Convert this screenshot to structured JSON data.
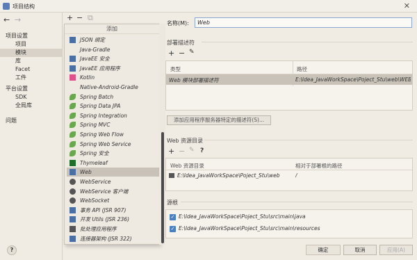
{
  "window": {
    "title": "项目结构",
    "close_glyph": "✕"
  },
  "nav": {
    "back": "←",
    "forward": "→"
  },
  "sidebar": {
    "items": [
      {
        "label": "项目设置",
        "selected": false,
        "indent": false
      },
      {
        "label": "项目",
        "selected": false,
        "indent": true
      },
      {
        "label": "模块",
        "selected": true,
        "indent": true
      },
      {
        "label": "库",
        "selected": false,
        "indent": true
      },
      {
        "label": "Facet",
        "selected": false,
        "indent": true
      },
      {
        "label": "工件",
        "selected": false,
        "indent": true
      },
      {
        "label": "平台设置",
        "selected": false,
        "indent": false
      },
      {
        "label": "SDK",
        "selected": false,
        "indent": true
      },
      {
        "label": "全局库",
        "selected": false,
        "indent": true
      },
      {
        "label": "问题",
        "selected": false,
        "indent": false
      }
    ],
    "help": "?"
  },
  "mid_toolbar": {
    "add": "+",
    "remove": "−",
    "copy": "⧉"
  },
  "add_menu": {
    "header": "添加",
    "items": [
      {
        "label": "JSON 绑定",
        "icon": "json-icon",
        "color": "#4a6fa5",
        "selected": false
      },
      {
        "label": "Java-Gradle",
        "icon": "none",
        "color": "",
        "selected": false
      },
      {
        "label": "JavaEE 安全",
        "icon": "javaee-icon",
        "color": "#4a6fa5",
        "selected": false
      },
      {
        "label": "JavaEE 应用程序",
        "icon": "javaee-icon",
        "color": "#4a6fa5",
        "selected": false
      },
      {
        "label": "Kotlin",
        "icon": "kotlin-icon",
        "color": "#e0508a",
        "selected": false
      },
      {
        "label": "Native-Android-Gradle",
        "icon": "none",
        "color": "",
        "selected": false
      },
      {
        "label": "Spring Batch",
        "icon": "spring-icon",
        "color": "#6aa84f",
        "selected": false
      },
      {
        "label": "Spring Data JPA",
        "icon": "spring-icon",
        "color": "#6aa84f",
        "selected": false
      },
      {
        "label": "Spring Integration",
        "icon": "spring-icon",
        "color": "#6aa84f",
        "selected": false
      },
      {
        "label": "Spring MVC",
        "icon": "spring-icon",
        "color": "#6aa84f",
        "selected": false
      },
      {
        "label": "Spring Web Flow",
        "icon": "spring-icon",
        "color": "#6aa84f",
        "selected": false
      },
      {
        "label": "Spring Web Service",
        "icon": "spring-icon",
        "color": "#6aa84f",
        "selected": false
      },
      {
        "label": "Spring 安全",
        "icon": "spring-icon",
        "color": "#6aa84f",
        "selected": false
      },
      {
        "label": "Thymeleaf",
        "icon": "thymeleaf-icon",
        "color": "#1f6f2b",
        "selected": false
      },
      {
        "label": "Web",
        "icon": "web-icon",
        "color": "#4a6fa5",
        "selected": true
      },
      {
        "label": "WebService",
        "icon": "globe-icon",
        "color": "#555555",
        "selected": false
      },
      {
        "label": "WebService 客户端",
        "icon": "globe-icon",
        "color": "#555555",
        "selected": false
      },
      {
        "label": "WebSocket",
        "icon": "globe-icon",
        "color": "#555555",
        "selected": false
      },
      {
        "label": "事务 API (JSR 907)",
        "icon": "jee-icon",
        "color": "#4a6fa5",
        "selected": false
      },
      {
        "label": "开发 Utils (JSR 236)",
        "icon": "jee-icon",
        "color": "#4a6fa5",
        "selected": false
      },
      {
        "label": "批处理应用程序",
        "icon": "batch-icon",
        "color": "#555555",
        "selected": false
      },
      {
        "label": "连接器架构 (JSR 322)",
        "icon": "jee-icon",
        "color": "#4a6fa5",
        "selected": false
      }
    ]
  },
  "right": {
    "name_label": "名称(M):",
    "name_value": "Web",
    "deploy_title": "部署描述符",
    "deploy_toolbar": {
      "add": "+",
      "remove": "−",
      "edit": "✎"
    },
    "deploy_table": {
      "headers": [
        "类型",
        "路径"
      ],
      "rows": [
        {
          "type": "Web 模块部署描述符",
          "path": "E:\\Idea_JavaWorkSpace\\Poject_Stu\\web\\WEB-INF\\web.xml"
        }
      ]
    },
    "add_button": "添加应用程序服务器特定的描述符(S)...",
    "webres_title": "Web 资源目录",
    "webres_toolbar": {
      "add": "+",
      "remove": "−",
      "edit": "✎",
      "help": "?"
    },
    "webres_table": {
      "headers": [
        "Web 资源目录",
        "相对于部署根的路径"
      ],
      "rows": [
        {
          "dir": "E:\\Idea_JavaWorkSpace\\Poject_Stu\\web",
          "rel": "/"
        }
      ]
    },
    "source_title": "源根",
    "source_roots": [
      {
        "path": "E:\\Idea_JavaWorkSpace\\Poject_Stu\\src\\main\\java",
        "checked": true
      },
      {
        "path": "E:\\Idea_JavaWorkSpace\\Poject_Stu\\src\\main\\resources",
        "checked": true
      }
    ]
  },
  "buttons": {
    "ok": "确定",
    "cancel": "取消",
    "apply": "应用(A)"
  }
}
